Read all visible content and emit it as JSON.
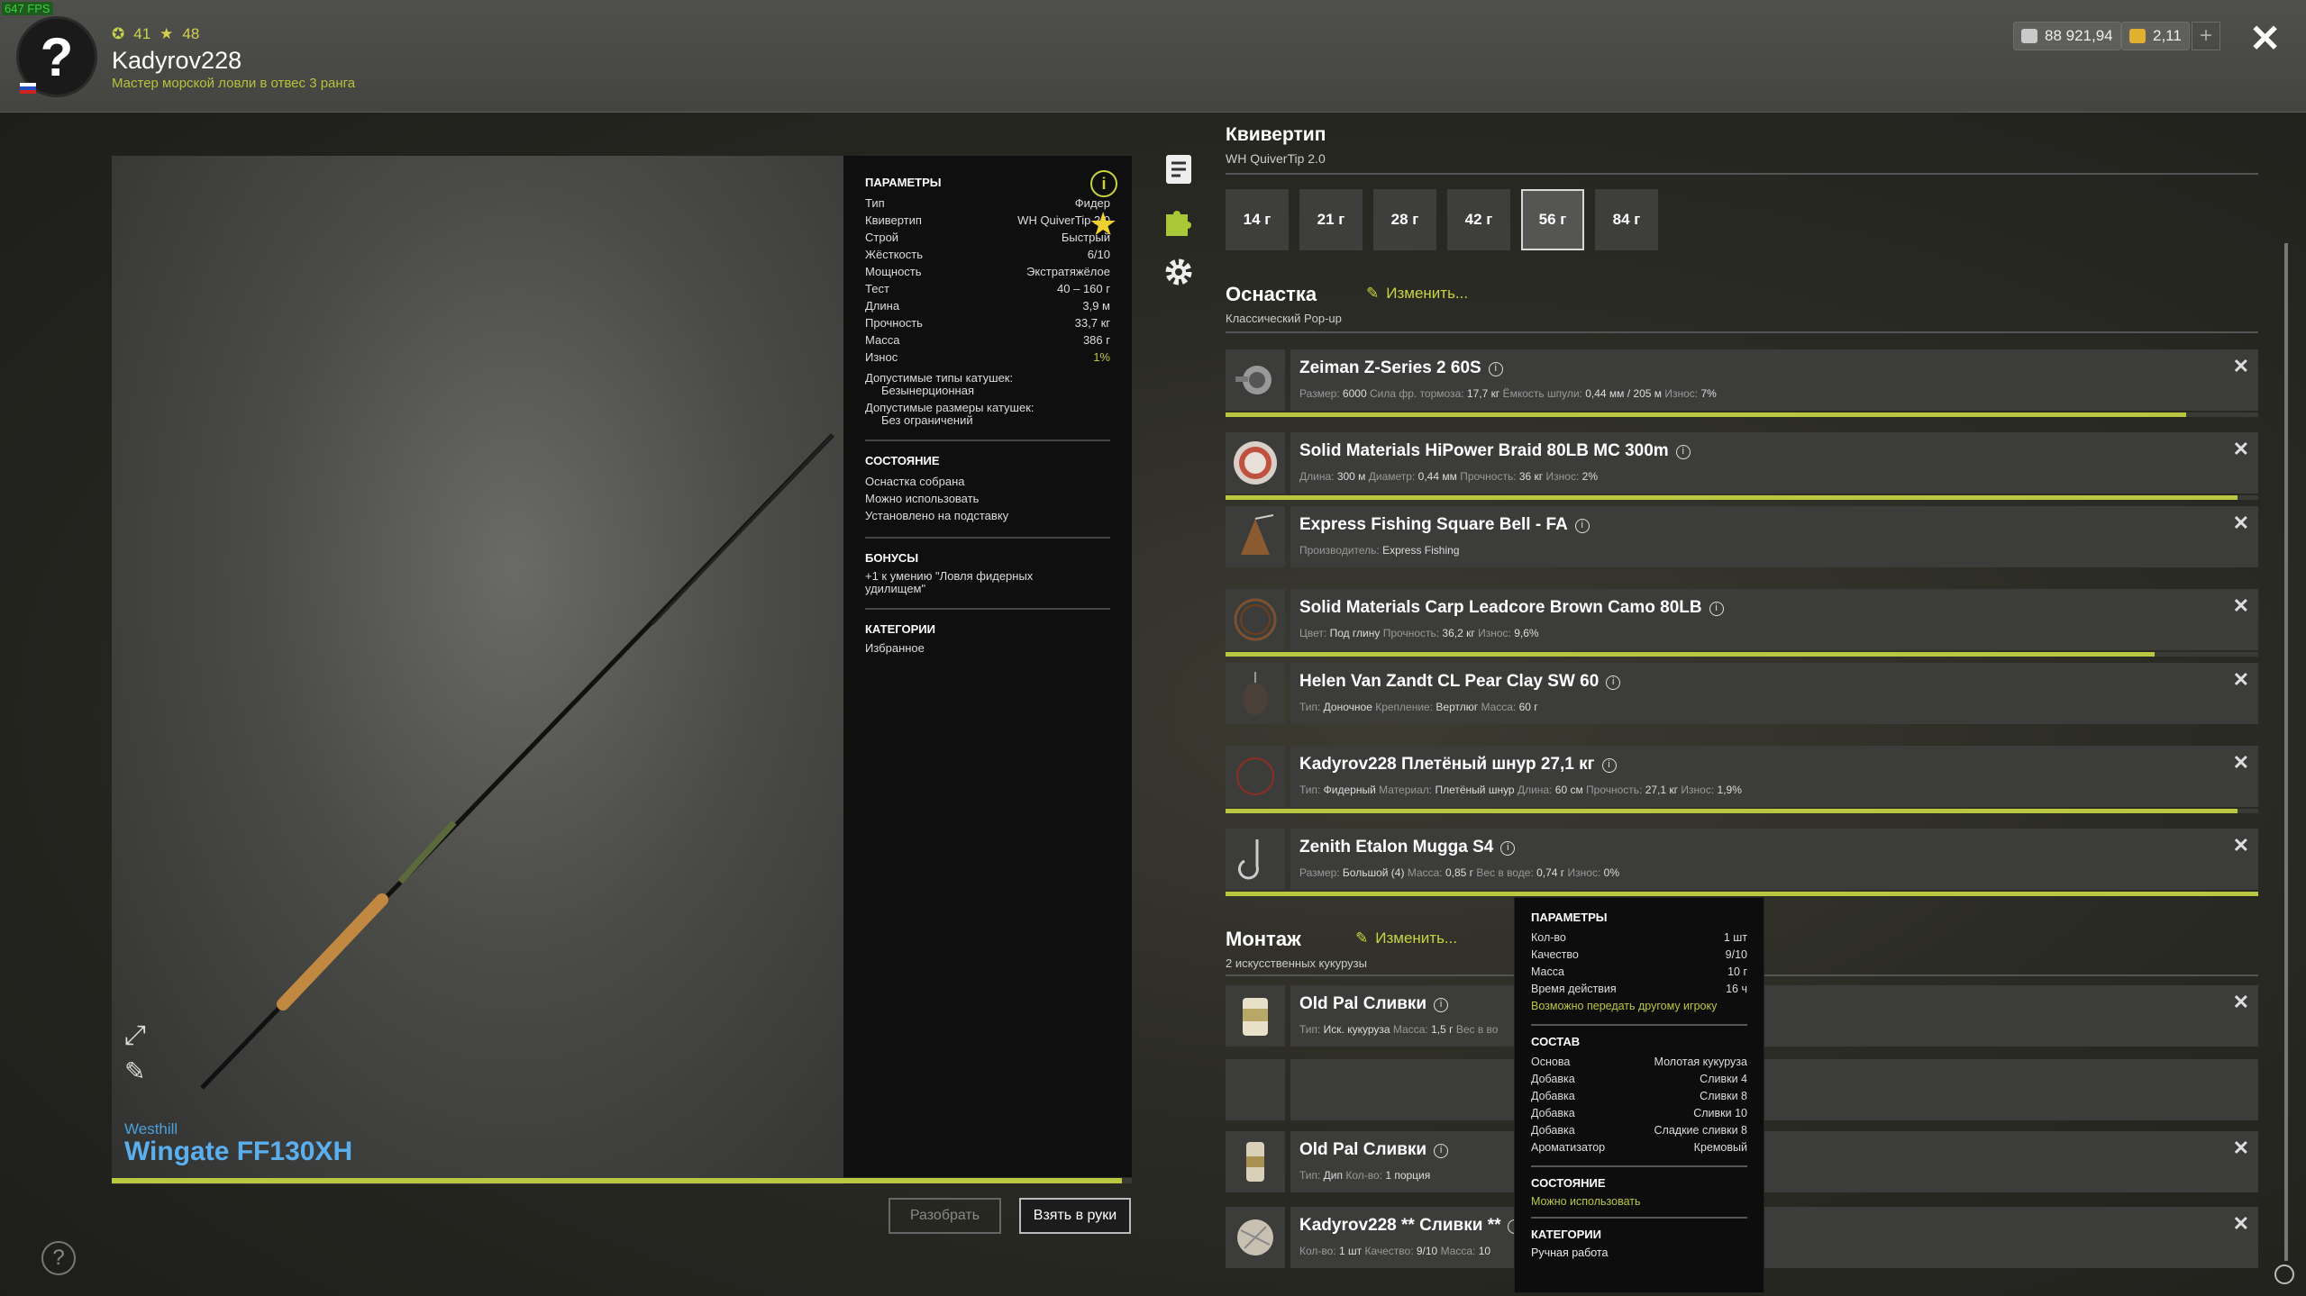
{
  "fps": "647 FPS",
  "player": {
    "level": "41",
    "stars": "48",
    "name": "Kadyrov228",
    "rank": "Мастер морской ловли в отвес 3 ранга",
    "silver": "88 921,94",
    "gold": "2,11"
  },
  "rod": {
    "brand": "Westhill",
    "model": "Wingate FF130XH",
    "panel": {
      "params_title": "ПАРАМЕТРЫ",
      "rows": [
        {
          "k": "Тип",
          "v": "Фидер"
        },
        {
          "k": "Квивертип",
          "v": "WH QuiverTip 2.0"
        },
        {
          "k": "Строй",
          "v": "Быстрый"
        },
        {
          "k": "Жёсткость",
          "v": "6/10"
        },
        {
          "k": "Мощность",
          "v": "Экстратяжёлое"
        },
        {
          "k": "Тест",
          "v": "40 – 160 г"
        },
        {
          "k": "Длина",
          "v": "3,9 м"
        },
        {
          "k": "Прочность",
          "v": "33,7 кг"
        },
        {
          "k": "Масса",
          "v": "386 г"
        },
        {
          "k": "Износ",
          "v": "1%"
        }
      ],
      "reel_types_label": "Допустимые типы катушек:",
      "reel_types_value": "Безынерционная",
      "reel_sizes_label": "Допустимые размеры катушек:",
      "reel_sizes_value": "Без ограничений",
      "state_title": "СОСТОЯНИЕ",
      "state_1": "Оснастка собрана",
      "state_2": "Можно использовать",
      "state_3": "Установлено на подставку",
      "bonus_title": "БОНУСЫ",
      "bonus_1": "+1 к умению \"Ловля фидерных удилищем\"",
      "cat_title": "КАТЕГОРИИ",
      "cat_1": "Избранное"
    },
    "wear_pct": 99
  },
  "buttons": {
    "disassemble": "Разобрать",
    "take": "Взять в руки"
  },
  "quivertip": {
    "title": "Квивертип",
    "subtitle": "WH QuiverTip 2.0",
    "weights": [
      "14 г",
      "21 г",
      "28 г",
      "42 г",
      "56 г",
      "84 г"
    ],
    "selected": "56 г"
  },
  "tackle": {
    "title": "Оснастка",
    "edit": "Изменить...",
    "subtitle": "Классический Pop-up",
    "items": [
      {
        "name": "Zeiman Z-Series 2 60S",
        "desc": [
          [
            "Размер:",
            "6000"
          ],
          [
            "Сила фр. тормоза:",
            "17,7 кг"
          ],
          [
            "Ёмкость шпули:",
            "0,44 мм / 205 м"
          ],
          [
            "Износ:",
            "7%"
          ]
        ],
        "wear": 93
      },
      {
        "name": "Solid Materials HiPower Braid 80LB MC 300m",
        "desc": [
          [
            "Длина:",
            "300 м"
          ],
          [
            "Диаметр:",
            "0,44 мм"
          ],
          [
            "Прочность:",
            "36 кг"
          ],
          [
            "Износ:",
            "2%"
          ]
        ],
        "wear": 98
      },
      {
        "name": "Express Fishing Square Bell - FA",
        "desc": [
          [
            "Производитель:",
            "Express Fishing"
          ]
        ],
        "wear": null
      },
      {
        "name": "Solid Materials Carp Leadcore Brown Camo 80LB",
        "desc": [
          [
            "Цвет:",
            "Под глину"
          ],
          [
            "Прочность:",
            "36,2 кг"
          ],
          [
            "Износ:",
            "9,6%"
          ]
        ],
        "wear": 90
      },
      {
        "name": "Helen Van Zandt CL Pear Clay SW 60",
        "desc": [
          [
            "Тип:",
            "Доночное"
          ],
          [
            "Крепление:",
            "Вертлюг"
          ],
          [
            "Масса:",
            "60 г"
          ]
        ],
        "wear": null
      },
      {
        "name": "Kadyrov228 Плетёный шнур 27,1 кг",
        "desc": [
          [
            "Тип:",
            "Фидерный"
          ],
          [
            "Материал:",
            "Плетёный шнур"
          ],
          [
            "Длина:",
            "60 см"
          ],
          [
            "Прочность:",
            "27,1 кг"
          ],
          [
            "Износ:",
            "1,9%"
          ]
        ],
        "wear": 98
      },
      {
        "name": "Zenith Etalon Mugga S4",
        "desc": [
          [
            "Размер:",
            "Большой (4)"
          ],
          [
            "Масса:",
            "0,85 г"
          ],
          [
            "Вес в воде:",
            "0,74 г"
          ],
          [
            "Износ:",
            "0%"
          ]
        ],
        "wear": 100
      }
    ]
  },
  "montage": {
    "title": "Монтаж",
    "edit": "Изменить...",
    "subtitle": "2 искусственных кукурузы",
    "items": [
      {
        "name": "Old Pal Сливки",
        "desc": [
          [
            "Тип:",
            "Иск. кукуруза"
          ],
          [
            "Масса:",
            "1,5 г"
          ],
          [
            "Вес в во",
            ""
          ]
        ]
      },
      {
        "name": "Old Pal Сливки",
        "desc": [
          [
            "Тип:",
            "Дип"
          ],
          [
            "Кол-во:",
            "1 порция"
          ]
        ]
      },
      {
        "name": "Kadyrov228 ** Сливки **",
        "desc": [
          [
            "Кол-во:",
            "1 шт"
          ],
          [
            "Качество:",
            "9/10"
          ],
          [
            "Масса:",
            "10"
          ]
        ]
      }
    ]
  },
  "tooltip": {
    "params_title": "ПАРАМЕТРЫ",
    "params": [
      {
        "k": "Кол-во",
        "v": "1 шт"
      },
      {
        "k": "Качество",
        "v": "9/10"
      },
      {
        "k": "Масса",
        "v": "10 г"
      },
      {
        "k": "Время действия",
        "v": "16 ч"
      }
    ],
    "transfer": "Возможно передать другому игроку",
    "comp_title": "СОСТАВ",
    "comp": [
      {
        "k": "Основа",
        "v": "Молотая кукуруза"
      },
      {
        "k": "Добавка",
        "v": "Сливки 4"
      },
      {
        "k": "Добавка",
        "v": "Сливки 8"
      },
      {
        "k": "Добавка",
        "v": "Сливки 10"
      },
      {
        "k": "Добавка",
        "v": "Сладкие сливки 8"
      },
      {
        "k": "Ароматизатор",
        "v": "Кремовый"
      }
    ],
    "state_title": "СОСТОЯНИЕ",
    "state": "Можно использовать",
    "cat_title": "КАТЕГОРИИ",
    "cat": "Ручная работа"
  },
  "colors": {
    "accent": "#b9c840",
    "link_blue": "#5aa8e8"
  },
  "icons": [
    "question-avatar-icon",
    "level-icon",
    "star-icon",
    "silver-coin-icon",
    "gold-coin-icon",
    "plus-icon",
    "close-icon",
    "info-icon",
    "notes-icon",
    "puzzle-icon",
    "gear-icon",
    "expand-icon",
    "pencil-icon",
    "edit-icon",
    "help-icon"
  ]
}
